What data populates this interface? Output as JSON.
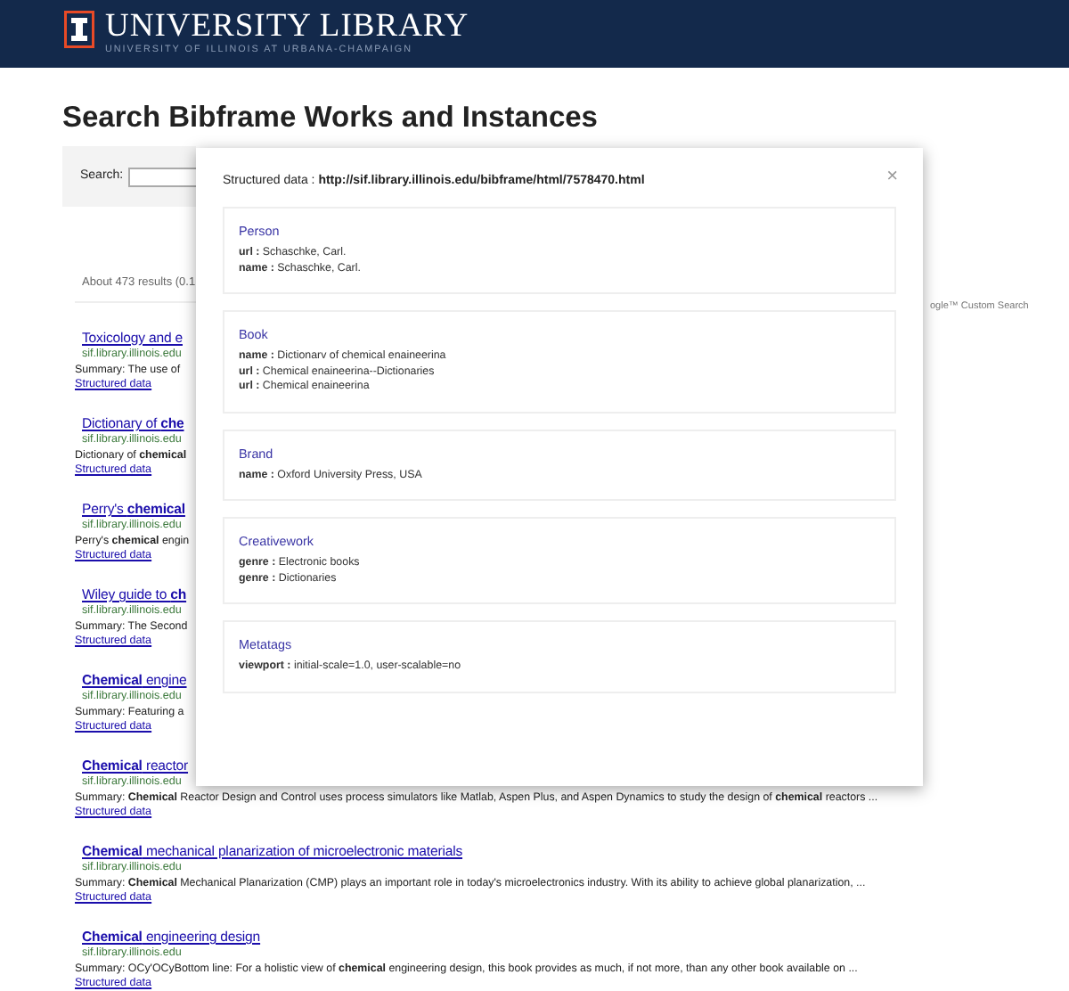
{
  "header": {
    "title": "UNIVERSITY LIBRARY",
    "subtitle": "UNIVERSITY OF ILLINOIS AT URBANA-CHAMPAIGN"
  },
  "page_title": "Search Bibframe Works and Instances",
  "search": {
    "label": "Search:"
  },
  "results_info": "About 473 results (0.1",
  "custom_search": "ogle™ Custom Search",
  "results": [
    {
      "title": "Toxicology and e",
      "url": "sif.library.illinois.edu",
      "summary": "Summary: The use of",
      "link": "Structured data"
    },
    {
      "title": "Dictionary of **che**",
      "url": "sif.library.illinois.edu",
      "summary": "Dictionary of **chemical**",
      "link": "Structured data"
    },
    {
      "title": "Perry's **chemical**",
      "url": "sif.library.illinois.edu",
      "summary": "Perry's **chemical** engin",
      "link": "Structured data"
    },
    {
      "title": "Wiley guide to **ch**",
      "url": "sif.library.illinois.edu",
      "summary": "Summary: The Second",
      "link": "Structured data"
    },
    {
      "title": "**Chemical** engine",
      "url": "sif.library.illinois.edu",
      "summary": "Summary: Featuring a",
      "link": "Structured data"
    },
    {
      "title": "**Chemical** reactor",
      "url": "sif.library.illinois.edu",
      "summary": "Summary: **Chemical** Reactor Design and Control uses process simulators like Matlab, Aspen Plus, and Aspen Dynamics to study the design of **chemical** reactors ...",
      "link": "Structured data"
    },
    {
      "title": "**Chemical** mechanical planarization of microelectronic materials",
      "url": "sif.library.illinois.edu",
      "summary": "Summary: **Chemical** Mechanical Planarization (CMP) plays an important role in today's microelectronics industry. With its ability to achieve global planarization, ...",
      "link": "Structured data"
    },
    {
      "title": "**Chemical** engineering design",
      "url": "sif.library.illinois.edu",
      "summary": "Summary: OCy'OCyBottom line: For a holistic view of **chemical** engineering design, this book provides as much, if not more, than any other book available on  ...",
      "link": "Structured data"
    }
  ],
  "modal": {
    "title": "Structured data : **http://sif.library.illinois.edu/bibframe/html/7578470.html**",
    "close": "×",
    "sections": [
      {
        "heading": "Person",
        "fields": [
          "**url :** Schaschke, Carl.",
          "**name :** Schaschke, Carl."
        ]
      },
      {
        "heading": "Book",
        "fields": [
          "**name :** Dictionarv of chemical enaineerina",
          "**url :** Chemical enaineerina--Dictionaries",
          "**url :** Chemical enaineerina"
        ]
      },
      {
        "heading": "Brand",
        "fields": [
          "**name :** Oxford University Press, USA"
        ]
      },
      {
        "heading": "Creativework",
        "fields": [
          "**genre :** Electronic books",
          "**genre :** Dictionaries"
        ]
      },
      {
        "heading": "Metatags",
        "fields": [
          "**viewport :** initial-scale=1.0, user-scalable=no"
        ]
      }
    ]
  }
}
